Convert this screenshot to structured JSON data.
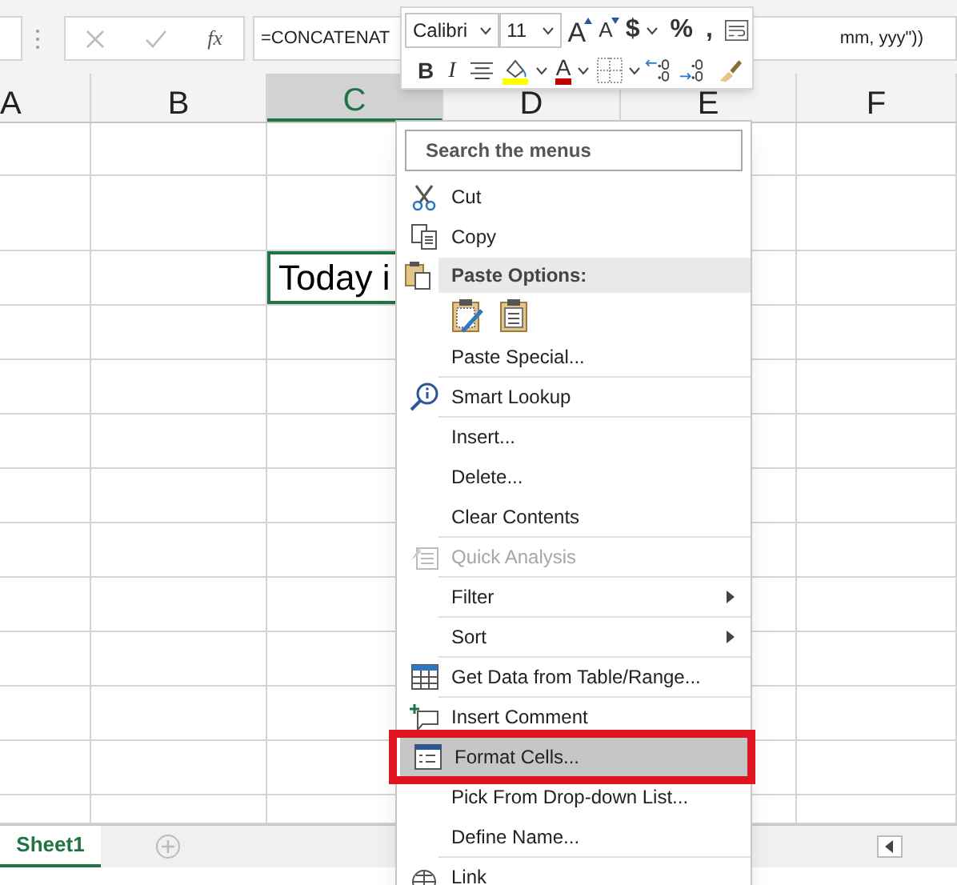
{
  "formula_bar": {
    "fx": "fx",
    "formula_start": "=CONCATENAT",
    "formula_end": "mm, yyy\"))"
  },
  "columns": [
    {
      "label": "A",
      "selected": false
    },
    {
      "label": "B",
      "selected": false
    },
    {
      "label": "C",
      "selected": true
    },
    {
      "label": "D",
      "selected": false
    },
    {
      "label": "E",
      "selected": false
    },
    {
      "label": "F",
      "selected": false
    }
  ],
  "active_cell": {
    "value": "Today i"
  },
  "mini_toolbar": {
    "row_1": [
      {
        "kind": "dropdown",
        "label": "Calibri"
      },
      {
        "kind": "dropdown",
        "label": "11"
      },
      {
        "kind": "grow",
        "label": "A"
      },
      {
        "kind": "shrink",
        "label": "A"
      },
      {
        "kind": "text",
        "label": "$",
        "caret": true
      },
      {
        "kind": "text",
        "label": "%",
        "caret": false
      },
      {
        "kind": "text",
        "label": ",",
        "caret": false
      },
      {
        "kind": "wrap"
      }
    ],
    "row_2": [
      {
        "kind": "bold",
        "label": "B"
      },
      {
        "kind": "italic",
        "label": "I"
      },
      {
        "kind": "align"
      },
      {
        "kind": "fill",
        "caret": true
      },
      {
        "kind": "fontcolor",
        "label": "A",
        "caret": true
      },
      {
        "kind": "borders",
        "caret": true
      },
      {
        "kind": "dec_up"
      },
      {
        "kind": "dec_down"
      },
      {
        "kind": "painter"
      }
    ]
  },
  "context_menu": {
    "search": {
      "placeholder": "Search the menus"
    },
    "items": [
      {
        "kind": "item",
        "label": "Cut",
        "disabled": false,
        "highlighted": false,
        "submenu": false,
        "separator_after": false
      },
      {
        "kind": "item",
        "label": "Copy",
        "disabled": false,
        "highlighted": false,
        "submenu": false,
        "separator_after": false
      },
      {
        "kind": "header",
        "label": "Paste Options:"
      },
      {
        "kind": "paste_icons"
      },
      {
        "kind": "item",
        "label": "Paste Special...",
        "disabled": false,
        "highlighted": false,
        "submenu": false,
        "separator_after": true
      },
      {
        "kind": "item",
        "label": "Smart Lookup",
        "disabled": false,
        "highlighted": false,
        "submenu": false,
        "separator_after": true
      },
      {
        "kind": "item",
        "label": "Insert...",
        "disabled": false,
        "highlighted": false,
        "submenu": false,
        "separator_after": false
      },
      {
        "kind": "item",
        "label": "Delete...",
        "disabled": false,
        "highlighted": false,
        "submenu": false,
        "separator_after": false
      },
      {
        "kind": "item",
        "label": "Clear Contents",
        "disabled": false,
        "highlighted": false,
        "submenu": false,
        "separator_after": true
      },
      {
        "kind": "item",
        "label": "Quick Analysis",
        "disabled": true,
        "highlighted": false,
        "submenu": false,
        "separator_after": true
      },
      {
        "kind": "item",
        "label": "Filter",
        "disabled": false,
        "highlighted": false,
        "submenu": true,
        "separator_after": true
      },
      {
        "kind": "item",
        "label": "Sort",
        "disabled": false,
        "highlighted": false,
        "submenu": true,
        "separator_after": true
      },
      {
        "kind": "item",
        "label": "Get Data from Table/Range...",
        "disabled": false,
        "highlighted": false,
        "submenu": false,
        "separator_after": true
      },
      {
        "kind": "item",
        "label": "Insert Comment",
        "disabled": false,
        "highlighted": false,
        "submenu": false,
        "separator_after": false
      },
      {
        "kind": "item",
        "label": "Format Cells...",
        "disabled": false,
        "highlighted": true,
        "submenu": false,
        "separator_after": false
      },
      {
        "kind": "item",
        "label": "Pick From Drop-down List...",
        "disabled": false,
        "highlighted": false,
        "submenu": false,
        "separator_after": false
      },
      {
        "kind": "item",
        "label": "Define Name...",
        "disabled": false,
        "highlighted": false,
        "submenu": false,
        "separator_after": true
      },
      {
        "kind": "item",
        "label": "Link",
        "disabled": false,
        "highlighted": false,
        "submenu": false,
        "separator_after": false
      }
    ]
  },
  "sheet_tabs": [
    {
      "label": "Sheet1",
      "selected": true
    }
  ]
}
